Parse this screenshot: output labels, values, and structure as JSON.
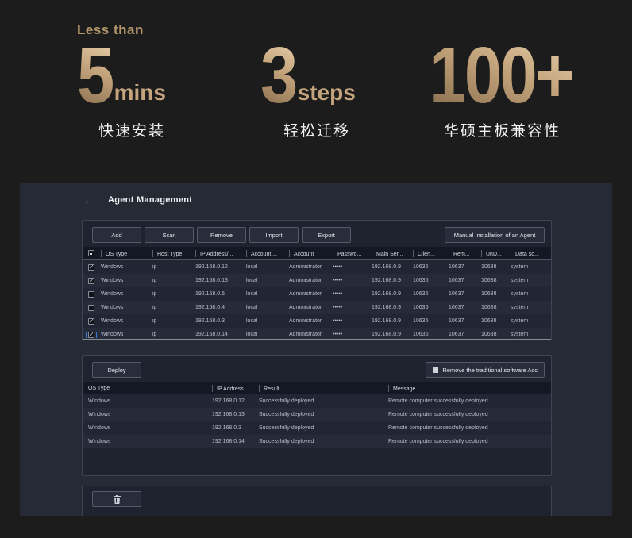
{
  "colors": {
    "gold_light": "#e0c7a2",
    "gold_dark": "#8c7150",
    "gold_text": "#c4a47c",
    "focus_blue": "#3a7bd5",
    "page_bg": "#1c1c1c",
    "panel_bg": "#252a35"
  },
  "stats": {
    "items": [
      {
        "prefix": "Less than",
        "number": "5",
        "suffix": "mins",
        "label": "快速安装"
      },
      {
        "prefix": "",
        "number": "3",
        "suffix": "steps",
        "label": "轻松迁移"
      },
      {
        "prefix": "",
        "number": "100+",
        "suffix": "",
        "label": "华硕主板兼容性"
      }
    ]
  },
  "app": {
    "back_icon": "←",
    "title": "Agent Management",
    "toolbar": {
      "add": "Add",
      "scan": "Scan",
      "remove": "Remove",
      "import": "Import",
      "export": "Export",
      "manual_install": "Manual Installation of an Agent"
    },
    "agent_table": {
      "header_checkbox_state": "indeterminate",
      "columns": [
        "OS Type",
        "Host Type",
        "IP Address/...",
        "Account ...",
        "Account",
        "Passwo...",
        "Main Ser...",
        "Clien...",
        "Rem...",
        "UnD...",
        "Data so..."
      ],
      "rows": [
        {
          "checked": true,
          "focused": false,
          "os": "Windows",
          "host": "ip",
          "ip_address": "192.168.0.12",
          "account_type": "local",
          "account": "Administrator",
          "password": "•••••",
          "main_server": "192.168.0.9",
          "client_port": "10636",
          "remote_port": "10637",
          "und_port": "10638",
          "data_source": "system"
        },
        {
          "checked": true,
          "focused": false,
          "os": "Windows",
          "host": "ip",
          "ip_address": "192.168.0.13",
          "account_type": "local",
          "account": "Administrator",
          "password": "•••••",
          "main_server": "192.168.0.9",
          "client_port": "10636",
          "remote_port": "10637",
          "und_port": "10638",
          "data_source": "system"
        },
        {
          "checked": false,
          "focused": false,
          "os": "Windows",
          "host": "ip",
          "ip_address": "192.168.0.5",
          "account_type": "local",
          "account": "Administrator",
          "password": "•••••",
          "main_server": "192.168.0.9",
          "client_port": "10636",
          "remote_port": "10637",
          "und_port": "10638",
          "data_source": "system"
        },
        {
          "checked": false,
          "focused": false,
          "os": "Windows",
          "host": "ip",
          "ip_address": "192.168.0.4",
          "account_type": "local",
          "account": "Administrator",
          "password": "•••••",
          "main_server": "192.168.0.9",
          "client_port": "10636",
          "remote_port": "10637",
          "und_port": "10638",
          "data_source": "system"
        },
        {
          "checked": true,
          "focused": false,
          "os": "Windows",
          "host": "ip",
          "ip_address": "192.168.0.3",
          "account_type": "local",
          "account": "Administrator",
          "password": "•••••",
          "main_server": "192.168.0.9",
          "client_port": "10636",
          "remote_port": "10637",
          "und_port": "10638",
          "data_source": "system"
        },
        {
          "checked": true,
          "focused": true,
          "os": "Windows",
          "host": "ip",
          "ip_address": "192.168.0.14",
          "account_type": "local",
          "account": "Administrator",
          "password": "•••••",
          "main_server": "192.168.0.9",
          "client_port": "10636",
          "remote_port": "10637",
          "und_port": "10638",
          "data_source": "system"
        }
      ]
    },
    "deploy_section": {
      "deploy_button": "Deploy",
      "remove_option_label": "Remove the traditional software Acc",
      "columns": [
        "OS Type",
        "IP Address...",
        "Result",
        "Message"
      ],
      "rows": [
        {
          "os": "Windows",
          "ip_address": "192.168.0.12",
          "result": "Successfully deployed",
          "message": "Remote computer successfully deployed"
        },
        {
          "os": "Windows",
          "ip_address": "192.168.0.13",
          "result": "Successfully deployed",
          "message": "Remote computer successfully deployed"
        },
        {
          "os": "Windows",
          "ip_address": "192.168.0.3",
          "result": "Successfully deployed",
          "message": "Remote computer successfully deployed"
        },
        {
          "os": "Windows",
          "ip_address": "192.168.0.14",
          "result": "Successfully deployed",
          "message": "Remote computer successfully deployed"
        }
      ]
    },
    "bottom_section": {
      "delete_icon": "trash"
    }
  }
}
